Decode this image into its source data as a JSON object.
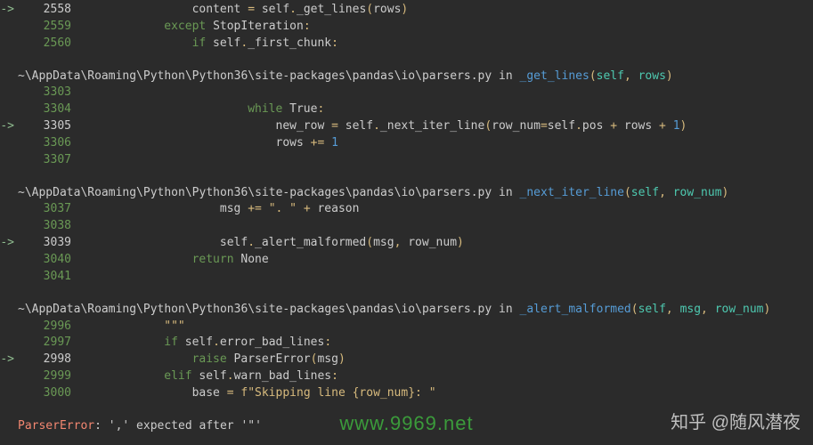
{
  "frames": [
    {
      "header": null,
      "lines": [
        {
          "arrow": true,
          "lineno": "2558",
          "indent": 14,
          "kind": "code_2558"
        },
        {
          "arrow": false,
          "lineno": "2559",
          "indent": 10,
          "kind": "code_2559"
        },
        {
          "arrow": false,
          "lineno": "2560",
          "indent": 14,
          "kind": "code_2560"
        }
      ]
    },
    {
      "header": {
        "path": "~\\AppData\\Roaming\\Python\\Python36\\site-packages\\pandas\\io\\parsers.py",
        "in": "in",
        "func": "_get_lines",
        "params": [
          "self",
          "rows"
        ]
      },
      "lines": [
        {
          "arrow": false,
          "lineno": "3303",
          "indent": 0,
          "kind": "blank"
        },
        {
          "arrow": false,
          "lineno": "3304",
          "indent": 22,
          "kind": "code_3304"
        },
        {
          "arrow": true,
          "lineno": "3305",
          "indent": 26,
          "kind": "code_3305"
        },
        {
          "arrow": false,
          "lineno": "3306",
          "indent": 26,
          "kind": "code_3306"
        },
        {
          "arrow": false,
          "lineno": "3307",
          "indent": 0,
          "kind": "blank"
        }
      ]
    },
    {
      "header": {
        "path": "~\\AppData\\Roaming\\Python\\Python36\\site-packages\\pandas\\io\\parsers.py",
        "in": "in",
        "func": "_next_iter_line",
        "params": [
          "self",
          "row_num"
        ]
      },
      "lines": [
        {
          "arrow": false,
          "lineno": "3037",
          "indent": 18,
          "kind": "code_3037"
        },
        {
          "arrow": false,
          "lineno": "3038",
          "indent": 0,
          "kind": "blank"
        },
        {
          "arrow": true,
          "lineno": "3039",
          "indent": 18,
          "kind": "code_3039"
        },
        {
          "arrow": false,
          "lineno": "3040",
          "indent": 14,
          "kind": "code_3040"
        },
        {
          "arrow": false,
          "lineno": "3041",
          "indent": 0,
          "kind": "blank"
        }
      ]
    },
    {
      "header": {
        "path": "~\\AppData\\Roaming\\Python\\Python36\\site-packages\\pandas\\io\\parsers.py",
        "in": "in",
        "func": "_alert_malformed",
        "params": [
          "self",
          "msg",
          "row_num"
        ]
      },
      "lines": [
        {
          "arrow": false,
          "lineno": "2996",
          "indent": 10,
          "kind": "code_2996"
        },
        {
          "arrow": false,
          "lineno": "2997",
          "indent": 10,
          "kind": "code_2997"
        },
        {
          "arrow": true,
          "lineno": "2998",
          "indent": 14,
          "kind": "code_2998"
        },
        {
          "arrow": false,
          "lineno": "2999",
          "indent": 10,
          "kind": "code_2999"
        },
        {
          "arrow": false,
          "lineno": "3000",
          "indent": 14,
          "kind": "code_3000"
        }
      ]
    }
  ],
  "tok": {
    "code_2558": [
      [
        "name",
        "content "
      ],
      [
        "op",
        "="
      ],
      [
        "name",
        " self"
      ],
      [
        "op",
        "."
      ],
      [
        "name",
        "_get_lines"
      ],
      [
        "paren",
        "("
      ],
      [
        "name",
        "rows"
      ],
      [
        "paren",
        ")"
      ]
    ],
    "code_2559": [
      [
        "kw",
        "except"
      ],
      [
        "name",
        " StopIteration"
      ],
      [
        "op",
        ":"
      ]
    ],
    "code_2560": [
      [
        "kw",
        "if"
      ],
      [
        "name",
        " self"
      ],
      [
        "op",
        "."
      ],
      [
        "name",
        "_first_chunk"
      ],
      [
        "op",
        ":"
      ]
    ],
    "code_3304": [
      [
        "kw",
        "while"
      ],
      [
        "name",
        " True"
      ],
      [
        "op",
        ":"
      ]
    ],
    "code_3305": [
      [
        "name",
        "new_row "
      ],
      [
        "op",
        "="
      ],
      [
        "name",
        " self"
      ],
      [
        "op",
        "."
      ],
      [
        "name",
        "_next_iter_line"
      ],
      [
        "paren",
        "("
      ],
      [
        "name",
        "row_num"
      ],
      [
        "op",
        "="
      ],
      [
        "name",
        "self"
      ],
      [
        "op",
        "."
      ],
      [
        "name",
        "pos "
      ],
      [
        "op",
        "+"
      ],
      [
        "name",
        " rows "
      ],
      [
        "op",
        "+"
      ],
      [
        "name",
        " "
      ],
      [
        "num",
        "1"
      ],
      [
        "paren",
        ")"
      ]
    ],
    "code_3306": [
      [
        "name",
        "rows "
      ],
      [
        "op",
        "+="
      ],
      [
        "name",
        " "
      ],
      [
        "num",
        "1"
      ]
    ],
    "code_3037": [
      [
        "name",
        "msg "
      ],
      [
        "op",
        "+="
      ],
      [
        "name",
        " "
      ],
      [
        "str",
        "\". \""
      ],
      [
        "name",
        " "
      ],
      [
        "op",
        "+"
      ],
      [
        "name",
        " reason"
      ]
    ],
    "code_3039": [
      [
        "name",
        "self"
      ],
      [
        "op",
        "."
      ],
      [
        "name",
        "_alert_malformed"
      ],
      [
        "paren",
        "("
      ],
      [
        "name",
        "msg"
      ],
      [
        "comma",
        ","
      ],
      [
        "name",
        " row_num"
      ],
      [
        "paren",
        ")"
      ]
    ],
    "code_3040": [
      [
        "kw",
        "return"
      ],
      [
        "name",
        " None"
      ]
    ],
    "code_2996": [
      [
        "str",
        "\"\"\""
      ]
    ],
    "code_2997": [
      [
        "kw",
        "if"
      ],
      [
        "name",
        " self"
      ],
      [
        "op",
        "."
      ],
      [
        "name",
        "error_bad_lines"
      ],
      [
        "op",
        ":"
      ]
    ],
    "code_2998": [
      [
        "kw",
        "raise"
      ],
      [
        "name",
        " ParserError"
      ],
      [
        "paren",
        "("
      ],
      [
        "name",
        "msg"
      ],
      [
        "paren",
        ")"
      ]
    ],
    "code_2999": [
      [
        "kw",
        "elif"
      ],
      [
        "name",
        " self"
      ],
      [
        "op",
        "."
      ],
      [
        "name",
        "warn_bad_lines"
      ],
      [
        "op",
        ":"
      ]
    ],
    "code_3000": [
      [
        "name",
        "base "
      ],
      [
        "op",
        "="
      ],
      [
        "name",
        " "
      ],
      [
        "str",
        "f\"Skipping line {row_num}: \""
      ]
    ]
  },
  "error": {
    "name": "ParserError",
    "msg": ": ',' expected after '\"'"
  },
  "watermark": {
    "url": "www.9969.net",
    "zhihu": "知乎 @随风潜夜"
  }
}
